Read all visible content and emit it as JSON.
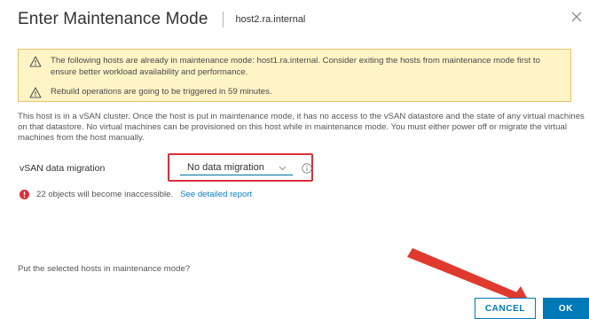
{
  "dialog": {
    "title": "Enter Maintenance Mode",
    "host": "host2.ra.internal"
  },
  "warnings": {
    "line1": "The following hosts are already in maintenance mode: host1.ra.internal. Consider exiting the hosts from maintenance mode first to ensure better workload availability and performance.",
    "line2": "Rebuild operations are going to be triggered in 59 minutes."
  },
  "description": "This host is in a vSAN cluster. Once the host is put in maintenance mode, it has no access to the vSAN datastore and the state of any virtual machines on that datastore. No virtual machines can be provisioned on this host while in maintenance mode. You must either power off or migrate the virtual machines from the host manually.",
  "migration": {
    "label": "vSAN data migration",
    "selected": "No data migration"
  },
  "error": {
    "text": "22 objects will become inaccessible.",
    "link": "See detailed report"
  },
  "question": "Put the selected hosts in maintenance mode?",
  "buttons": {
    "cancel": "CANCEL",
    "ok": "OK"
  },
  "colors": {
    "primary": "#0079b8",
    "warning_bg": "#fff4c6",
    "error": "#d9303a",
    "annotation": "#e03a2f"
  },
  "icons": {
    "close": "close-icon",
    "warning": "warning-triangle-icon",
    "info": "info-icon",
    "error": "error-circle-icon",
    "dropdown": "chevron-down-icon"
  }
}
